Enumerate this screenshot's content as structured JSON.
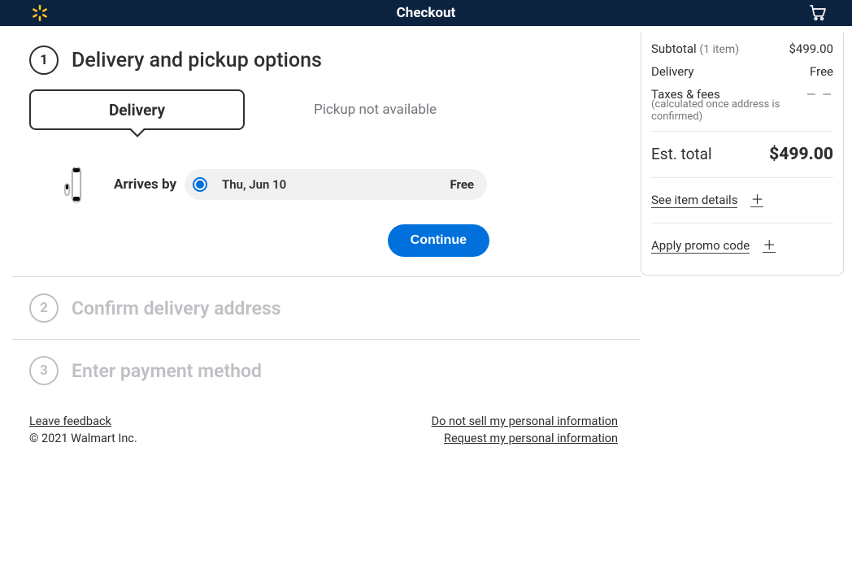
{
  "header": {
    "title": "Checkout"
  },
  "step1": {
    "num": "1",
    "title": "Delivery and pickup options",
    "tab_active": "Delivery",
    "tab_disabled": "Pickup not available",
    "arrives_label": "Arrives by",
    "ship_date": "Thu, Jun 10",
    "ship_cost": "Free",
    "continue": "Continue"
  },
  "step2": {
    "num": "2",
    "title": "Confirm delivery address"
  },
  "step3": {
    "num": "3",
    "title": "Enter payment method"
  },
  "order": {
    "subtotal_label": "Subtotal",
    "subtotal_qty": "(1 item)",
    "subtotal_val": "$499.00",
    "delivery_label": "Delivery",
    "delivery_val": "Free",
    "taxes_label": "Taxes & fees",
    "taxes_val": "— —",
    "taxes_note": "(calculated once address is confirmed)",
    "est_label": "Est. total",
    "est_val": "$499.00",
    "see_items": "See item details",
    "promo": "Apply promo code"
  },
  "footer": {
    "feedback": "Leave feedback",
    "copyright": "© 2021 Walmart Inc.",
    "donotsell": "Do not sell my personal information",
    "request": "Request my personal information"
  }
}
